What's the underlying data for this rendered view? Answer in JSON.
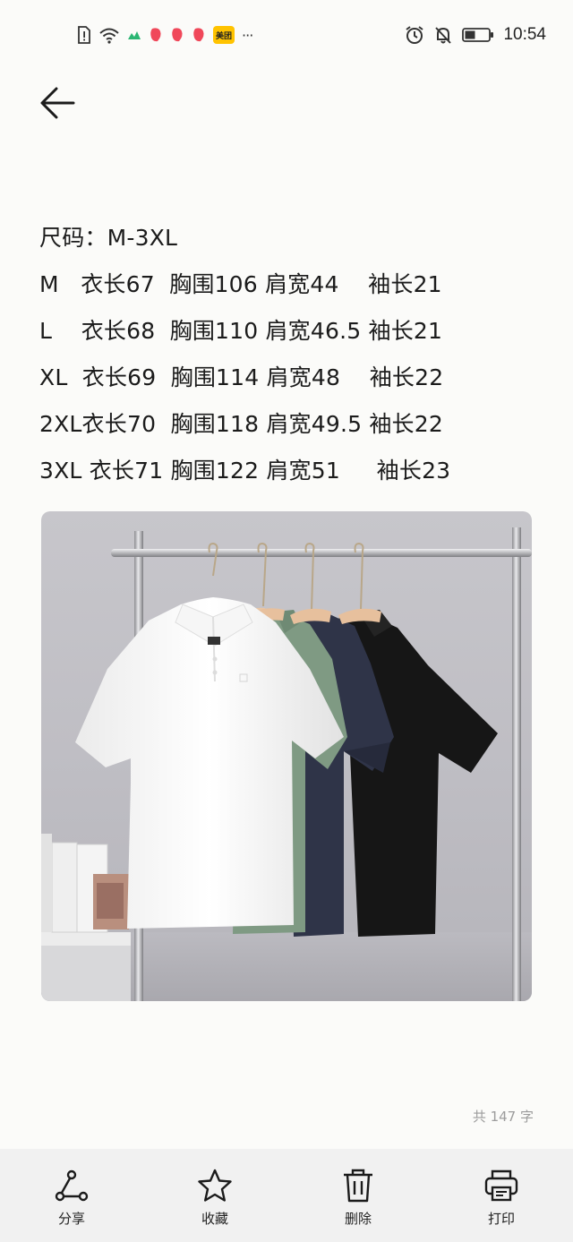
{
  "status_bar": {
    "time": "10:54",
    "app_badge": "美团",
    "overflow_dots": "···"
  },
  "note": {
    "lines": [
      "尺码：M-3XL",
      "M   衣长67  胸围106 肩宽44    袖长21",
      "L    衣长68  胸围110 肩宽46.5 袖长21",
      "XL  衣长69  胸围114 肩宽48    袖长22",
      "2XL衣长70  胸围118 肩宽49.5 袖长22",
      "3XL 衣长71 胸围122 肩宽51     袖长23"
    ],
    "char_count": "共 147 字"
  },
  "toolbar": {
    "share_label": "分享",
    "favorite_label": "收藏",
    "delete_label": "删除",
    "print_label": "打印"
  },
  "photo": {
    "shirt_colors": [
      "#ffffff",
      "#7f9a83",
      "#2f3448",
      "#161616"
    ],
    "background_color": "#c2c1c7"
  }
}
